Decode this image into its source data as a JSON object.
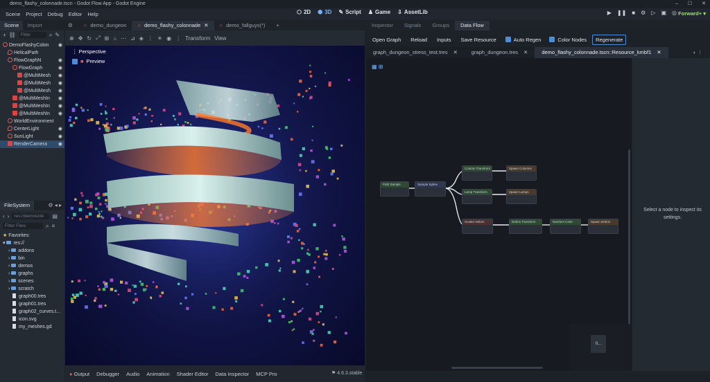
{
  "window": {
    "title": "demo_flashy_colonnade.tscn - Godot Flow App - Godot Engine"
  },
  "menu": [
    "Scene",
    "Project",
    "Debug",
    "Editor",
    "Help"
  ],
  "main_buttons": [
    "2D",
    "3D",
    "Script",
    "Game",
    "AssetLib"
  ],
  "renderer": "Forward+",
  "left_tabs": {
    "scene": "Scene",
    "import": "Import"
  },
  "scene_filter_placeholder": "Filter",
  "scene_tree": [
    {
      "label": "DemoFlashyColon",
      "depth": 0
    },
    {
      "label": "HelicalPath",
      "depth": 1
    },
    {
      "label": "FlowGraphN",
      "depth": 1
    },
    {
      "label": "FlowGraph",
      "depth": 2
    },
    {
      "label": "@MultiMesh",
      "depth": 3
    },
    {
      "label": "@MultiMesh",
      "depth": 3
    },
    {
      "label": "@MultiMesh",
      "depth": 3
    },
    {
      "label": "@MultiMeshIn",
      "depth": 2
    },
    {
      "label": "@MultiMeshIn",
      "depth": 2
    },
    {
      "label": "@MultiMeshIn",
      "depth": 2
    },
    {
      "label": "WorldEnvironment",
      "depth": 1
    },
    {
      "label": "CenterLight",
      "depth": 1
    },
    {
      "label": "SunLight",
      "depth": 1
    },
    {
      "label": "RenderCamera",
      "depth": 1
    }
  ],
  "filesystem": {
    "title": "FileSystem",
    "path": "res://demos/de",
    "filter_placeholder": "Filter Files",
    "favorites": "Favorites:",
    "root": "res://",
    "folders": [
      "addons",
      "bin",
      "demos",
      "graphs",
      "scenes",
      "scratch"
    ],
    "files": [
      "graph00.tres",
      "graph01.tres",
      "graph02_curves.t...",
      "icon.svg",
      "my_meshes.gd"
    ]
  },
  "scene_tabs": [
    "demo_dungeon",
    "demo_flashy_colonnade",
    "demo_fallguys(*)"
  ],
  "viewport_toolbar": {
    "transform": "Transform",
    "view": "View"
  },
  "viewport": {
    "perspective": "Perspective",
    "preview": "Preview"
  },
  "bottom_tabs": [
    "Output",
    "Debugger",
    "Audio",
    "Animation",
    "Shader Editor",
    "Data Inspector",
    "MCP Pro"
  ],
  "version": "4.6.3.stable",
  "right_tabs": [
    "Inspector",
    "Signals",
    "Groups",
    "Data Flow"
  ],
  "dataflow_toolbar": {
    "open_graph": "Open Graph",
    "reload": "Reload",
    "inputs": "Inputs",
    "save_resource": "Save Resource",
    "auto_regen": "Auto Regen",
    "color_nodes": "Color Nodes",
    "regenerate": "Regenerate"
  },
  "graph_tabs": [
    "graph_dungeon_stress_test.tres",
    "graph_dungeon.tres",
    "demo_flashy_colonnade.tscn::Resource_kmbf1"
  ],
  "inspector_message": "Select a node to inspect its settings.",
  "minimap_label": "0...",
  "graph_nodes": [
    {
      "label": "Path Sample",
      "tone": "g"
    },
    {
      "label": "Sample Spline",
      "tone": "b"
    },
    {
      "label": "Column Transform",
      "tone": "g"
    },
    {
      "label": "Spawn Columns",
      "tone": "br"
    },
    {
      "label": "Lamp Transform",
      "tone": "g"
    },
    {
      "label": "Spawn Lamps",
      "tone": "br"
    },
    {
      "label": "Scatter Debris",
      "tone": "r"
    },
    {
      "label": "Debris Transform",
      "tone": "g"
    },
    {
      "label": "Random Color",
      "tone": "g"
    },
    {
      "label": "Spawn Debris",
      "tone": "br"
    }
  ],
  "colors": {
    "accent": "#4a8ed8",
    "active_blue": "#6fb3ff",
    "renderer_green": "#9be070"
  }
}
